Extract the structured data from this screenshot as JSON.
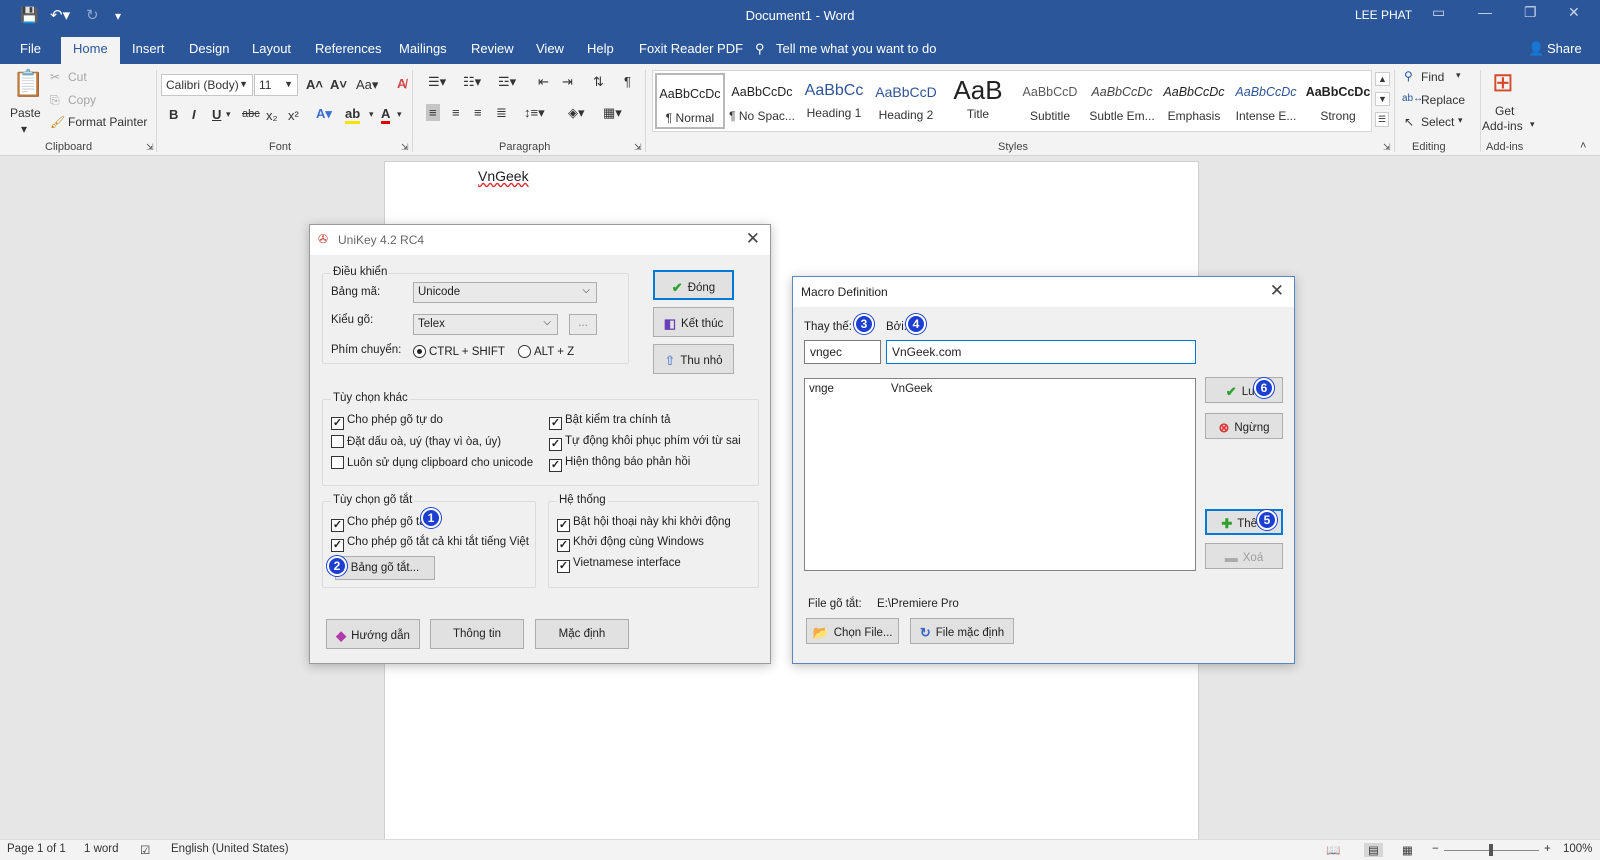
{
  "window": {
    "title": "Document1  -  Word",
    "user": "LEE PHAT"
  },
  "tabs": [
    "File",
    "Home",
    "Insert",
    "Design",
    "Layout",
    "References",
    "Mailings",
    "Review",
    "View",
    "Help",
    "Foxit Reader PDF"
  ],
  "tell_me": "Tell me what you want to do",
  "share": "Share",
  "clipboard": {
    "paste": "Paste",
    "cut": "Cut",
    "copy": "Copy",
    "format_painter": "Format Painter",
    "group": "Clipboard"
  },
  "font": {
    "name": "Calibri (Body)",
    "size": "11",
    "group": "Font"
  },
  "paragraph": {
    "group": "Paragraph"
  },
  "styles": {
    "group": "Styles",
    "items": [
      {
        "preview": "AaBbCcDc",
        "name": "¶ Normal"
      },
      {
        "preview": "AaBbCcDc",
        "name": "¶ No Spac..."
      },
      {
        "preview": "AaBbCc",
        "name": "Heading 1"
      },
      {
        "preview": "AaBbCcD",
        "name": "Heading 2"
      },
      {
        "preview": "AaB",
        "name": "Title"
      },
      {
        "preview": "AaBbCcD",
        "name": "Subtitle"
      },
      {
        "preview": "AaBbCcDc",
        "name": "Subtle Em..."
      },
      {
        "preview": "AaBbCcDc",
        "name": "Emphasis"
      },
      {
        "preview": "AaBbCcDc",
        "name": "Intense E..."
      },
      {
        "preview": "AaBbCcDc",
        "name": "Strong"
      }
    ]
  },
  "editing": {
    "find": "Find",
    "replace": "Replace",
    "select": "Select",
    "group": "Editing"
  },
  "addins": {
    "get_line1": "Get",
    "get_line2": "Add-ins",
    "group": "Add-ins"
  },
  "document": {
    "text": "VnGeek"
  },
  "statusbar": {
    "page": "Page 1 of 1",
    "words": "1 word",
    "language": "English (United States)",
    "zoom": "100%"
  },
  "unikey": {
    "title": "UniKey 4.2 RC4",
    "control_group": "Điều khiển",
    "charset_label": "Bảng mã:",
    "charset_value": "Unicode",
    "input_label": "Kiểu gõ:",
    "input_value": "Telex",
    "more_label": "...",
    "switch_label": "Phím chuyển:",
    "switch_opt1": "CTRL + SHIFT",
    "switch_opt2": "ALT + Z",
    "btn_close": "Đóng",
    "btn_exit": "Kết thúc",
    "btn_minimize": "Thu nhỏ",
    "other_group": "Tùy chọn khác",
    "opt1": "Cho phép gõ tự do",
    "opt2": "Đặt dấu oà, uý (thay vì òa, úy)",
    "opt3": "Luôn sử dụng clipboard cho unicode",
    "opt4": "Bật kiểm tra chính tả",
    "opt5": "Tự động khôi phục phím với từ sai",
    "opt6": "Hiện thông báo phản hồi",
    "macro_group": "Tùy chọn gõ tắt",
    "macro1": "Cho phép gõ tắt",
    "macro2": "Cho phép gõ tắt cả khi tắt tiếng Việt",
    "macro_table": "Bảng gõ tắt...",
    "system_group": "Hệ thống",
    "sys1": "Bật hội thoại này khi khởi động",
    "sys2": "Khởi động cùng Windows",
    "sys3": "Vietnamese interface",
    "btn_help": "Hướng dẫn",
    "btn_info": "Thông tin",
    "btn_default": "Mặc định"
  },
  "macro": {
    "title": "Macro Definition",
    "replace_label": "Thay thế:",
    "by_label": "Bởi:",
    "replace_value": "vngec",
    "by_value": "VnGeek.com",
    "entries": [
      {
        "key": "vnge",
        "value": "VnGeek"
      }
    ],
    "btn_save": "Lưu",
    "btn_stop": "Ngừng",
    "btn_add": "Thêm",
    "btn_delete": "Xoá",
    "file_label": "File gõ tắt:",
    "file_value": "E:\\Premiere Pro",
    "btn_choose": "Chọn File...",
    "btn_default_file": "File mặc định"
  },
  "badges": [
    "1",
    "2",
    "3",
    "4",
    "5",
    "6"
  ],
  "colors": {
    "word_blue": "#2b579a",
    "badge_blue": "#1d3fd1",
    "focus": "#0078d7"
  }
}
